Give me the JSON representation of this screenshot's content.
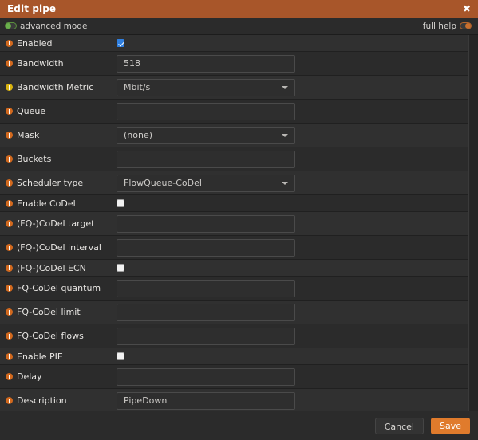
{
  "titlebar": {
    "title": "Edit pipe",
    "close_label": "✖"
  },
  "modebar": {
    "advanced_label": "advanced mode",
    "advanced_state": "on",
    "help_label": "full help",
    "help_state": "off"
  },
  "colors": {
    "titlebar_bg": "#a8562a",
    "accent": "#e07b2c",
    "info_orange": "#d2691e",
    "info_gold": "#d9b310",
    "checkbox_checked": "#2f7fe0",
    "toggle_on": "#6ab04c"
  },
  "form": {
    "rows": [
      {
        "label": "Enabled",
        "icon": "info-icon-orange",
        "type": "checkbox",
        "value": "checked",
        "placeholder": ""
      },
      {
        "label": "Bandwidth",
        "icon": "info-icon-orange",
        "type": "text",
        "value": "518",
        "placeholder": ""
      },
      {
        "label": "Bandwidth Metric",
        "icon": "info-icon-gold",
        "type": "select",
        "value": "Mbit/s",
        "placeholder": ""
      },
      {
        "label": "Queue",
        "icon": "info-icon-orange",
        "type": "text",
        "value": "",
        "placeholder": ""
      },
      {
        "label": "Mask",
        "icon": "info-icon-orange",
        "type": "select",
        "value": "(none)",
        "placeholder": ""
      },
      {
        "label": "Buckets",
        "icon": "info-icon-orange",
        "type": "text",
        "value": "",
        "placeholder": ""
      },
      {
        "label": "Scheduler type",
        "icon": "info-icon-orange",
        "type": "select",
        "value": "FlowQueue-CoDel",
        "placeholder": ""
      },
      {
        "label": "Enable CoDel",
        "icon": "info-icon-orange",
        "type": "checkbox",
        "value": "unchecked",
        "placeholder": ""
      },
      {
        "label": "(FQ-)CoDel target",
        "icon": "info-icon-orange",
        "type": "text",
        "value": "",
        "placeholder": ""
      },
      {
        "label": "(FQ-)CoDel interval",
        "icon": "info-icon-orange",
        "type": "text",
        "value": "",
        "placeholder": ""
      },
      {
        "label": "(FQ-)CoDel ECN",
        "icon": "info-icon-orange",
        "type": "checkbox",
        "value": "unchecked",
        "placeholder": ""
      },
      {
        "label": "FQ-CoDel quantum",
        "icon": "info-icon-orange",
        "type": "text",
        "value": "",
        "placeholder": ""
      },
      {
        "label": "FQ-CoDel limit",
        "icon": "info-icon-orange",
        "type": "text",
        "value": "",
        "placeholder": ""
      },
      {
        "label": "FQ-CoDel flows",
        "icon": "info-icon-orange",
        "type": "text",
        "value": "",
        "placeholder": ""
      },
      {
        "label": "Enable PIE",
        "icon": "info-icon-orange",
        "type": "checkbox",
        "value": "unchecked",
        "placeholder": ""
      },
      {
        "label": "Delay",
        "icon": "info-icon-orange",
        "type": "text",
        "value": "",
        "placeholder": ""
      },
      {
        "label": "Description",
        "icon": "info-icon-orange",
        "type": "text",
        "value": "PipeDown",
        "placeholder": ""
      }
    ]
  },
  "footer": {
    "cancel_label": "Cancel",
    "save_label": "Save"
  }
}
